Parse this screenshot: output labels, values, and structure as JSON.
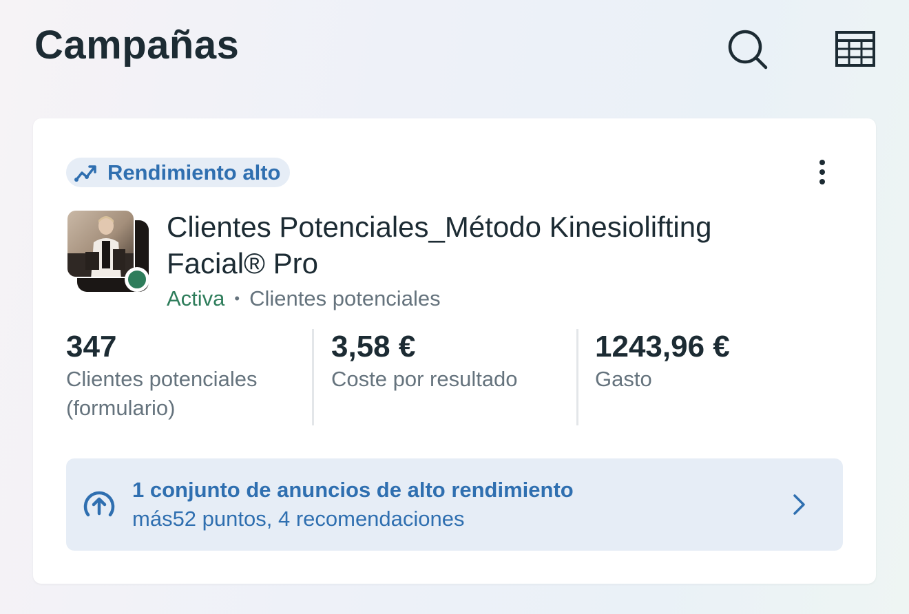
{
  "header": {
    "title": "Campañas",
    "search_icon": "search-icon",
    "table_icon": "table-view-icon"
  },
  "campaign": {
    "badge_label": "Rendimiento alto",
    "badge_icon": "trending-up-icon",
    "title": "Clientes Potenciales_Método Kinesiolifting Facial® Pro",
    "status": "Activa",
    "separator": "•",
    "objective": "Clientes potenciales",
    "status_color": "#2e7d5b",
    "metrics": [
      {
        "value": "347",
        "label": "Clientes potenciales (formulario)"
      },
      {
        "value": "3,58 €",
        "label": "Coste por resultado"
      },
      {
        "value": "1243,96 €",
        "label": "Gasto"
      }
    ],
    "recommendation": {
      "title": "1 conjunto de anuncios de alto rendimiento",
      "subtitle": "más52 puntos, 4 recomendaciones",
      "icon": "upgrade-arrow-icon"
    }
  },
  "colors": {
    "accent": "#2f6fb0",
    "badge_bg": "#e6edf6",
    "text": "#1c2b33",
    "muted": "#65737d"
  }
}
